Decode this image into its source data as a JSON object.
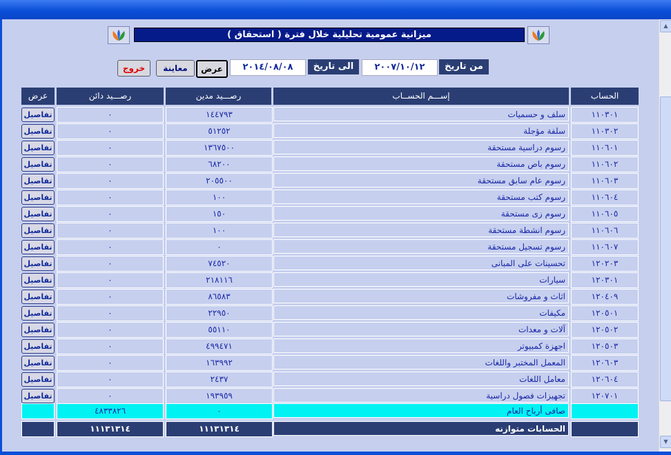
{
  "header": {
    "title": "ميزانية عمومية تحليلية خلال فترة   (  استحقاق  )",
    "from_label": "من تاريخ",
    "from_date": "٢٠٠٧/١٠/١٢",
    "to_label": "الى تاريخ",
    "to_date": "٢٠١٤/٠٨/٠٨"
  },
  "buttons": {
    "show": "عرض",
    "preview": "معاينة",
    "exit": "خروج"
  },
  "columns": {
    "account": "الحساب",
    "name": "إســـم  الحســاب",
    "debit": "رصـــيد مدين",
    "credit": "رصـــيد دائن",
    "view": "عرض"
  },
  "rows": [
    {
      "account": "١١٠٣٠١",
      "name": "سلف و حسميات",
      "debit": "١٤٤٧٩٣",
      "credit": "٠",
      "action": "تفاصيل"
    },
    {
      "account": "١١٠٣٠٢",
      "name": "سلفة مؤجلة",
      "debit": "٥١٢٥٢",
      "credit": "٠",
      "action": "تفاصيل"
    },
    {
      "account": "١١٠٦٠١",
      "name": "رسوم دراسية مستحقة",
      "debit": "١٣٦٧٥٠٠",
      "credit": "٠",
      "action": "تفاصيل"
    },
    {
      "account": "١١٠٦٠٢",
      "name": "رسوم باص مستحقة",
      "debit": "٦٨٢٠٠",
      "credit": "٠",
      "action": "تفاصيل"
    },
    {
      "account": "١١٠٦٠٣",
      "name": "رسوم عام سابق مستحقة",
      "debit": "٢٠٥٥٠٠",
      "credit": "٠",
      "action": "تفاصيل"
    },
    {
      "account": "١١٠٦٠٤",
      "name": "رسوم كتب مستحقة",
      "debit": "١٠٠",
      "credit": "٠",
      "action": "تفاصيل"
    },
    {
      "account": "١١٠٦٠٥",
      "name": "رسوم زى مستحقة",
      "debit": "١٥٠",
      "credit": "٠",
      "action": "تفاصيل"
    },
    {
      "account": "١١٠٦٠٦",
      "name": "رسوم انشطة مستحقة",
      "debit": "١٠٠",
      "credit": "٠",
      "action": "تفاصيل"
    },
    {
      "account": "١١٠٦٠٧",
      "name": "رسوم تسجيل مستحقة",
      "debit": "٠",
      "credit": "٠",
      "action": "تفاصيل"
    },
    {
      "account": "١٢٠٢٠٣",
      "name": "تحسينات على المبانى",
      "debit": "٧٤٥٢٠",
      "credit": "٠",
      "action": "تفاصيل"
    },
    {
      "account": "١٢٠٣٠١",
      "name": "سيارات",
      "debit": "٢١٨١١٦",
      "credit": "٠",
      "action": "تفاصيل"
    },
    {
      "account": "١٢٠٤٠٩",
      "name": "اثاث و مفروشات",
      "debit": "٨٦٥٨٣",
      "credit": "٠",
      "action": "تفاصيل"
    },
    {
      "account": "١٢٠٥٠١",
      "name": "مكيفات",
      "debit": "٢٢٩٥٠",
      "credit": "٠",
      "action": "تفاصيل"
    },
    {
      "account": "١٢٠٥٠٢",
      "name": "آلات و معدات",
      "debit": "٥٥١١٠",
      "credit": "٠",
      "action": "تفاصيل"
    },
    {
      "account": "١٢٠٥٠٣",
      "name": "اجهزة كمبيوتر",
      "debit": "٤٩٩٤٧١",
      "credit": "٠",
      "action": "تفاصيل"
    },
    {
      "account": "١٢٠٦٠٣",
      "name": "المعمل المختبر واللغات",
      "debit": "١٦٣٩٩٢",
      "credit": "٠",
      "action": "تفاصيل"
    },
    {
      "account": "١٢٠٦٠٤",
      "name": "معامل اللغات",
      "debit": "٢٤٣٧",
      "credit": "٠",
      "action": "تفاصيل"
    },
    {
      "account": "١٢٠٧٠١",
      "name": "تجهيزات فصول دراسية",
      "debit": "١٩٣٩٥٩",
      "credit": "٠",
      "action": "تفاصيل"
    }
  ],
  "net_profit": {
    "label": "صافى أرباح العام",
    "debit": "٠",
    "credit": "٤٨٣٣٨٢٦"
  },
  "totals": {
    "label": "الحسابات متوازنه",
    "debit": "١١١٣١٣١٤",
    "credit": "١١١٣١٣١٤"
  },
  "colors": {
    "title_bar": "#0a4fd8",
    "panel": "#c6cfee",
    "header_fill": "#2b3e74",
    "net_row": "#00f2f2",
    "text": "#1a28a8",
    "exit_text": "#e00000"
  },
  "icons": [
    "logo-icon",
    "scroll-up-icon",
    "scroll-down-icon"
  ]
}
